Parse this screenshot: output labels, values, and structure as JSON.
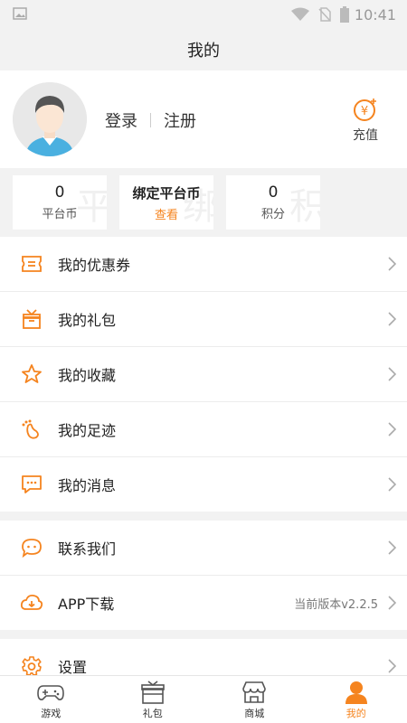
{
  "status": {
    "time": "10:41"
  },
  "title": "我的",
  "profile": {
    "login": "登录",
    "register": "注册",
    "recharge": "充值"
  },
  "stats": [
    {
      "value": "0",
      "label": "平台币",
      "watermark": "平"
    },
    {
      "value": "绑定平台币",
      "label": "查看",
      "watermark": "绑"
    },
    {
      "value": "0",
      "label": "积分",
      "watermark": "积"
    }
  ],
  "menu_group1": [
    {
      "label": "我的优惠券",
      "icon": "coupon-icon"
    },
    {
      "label": "我的礼包",
      "icon": "gift-icon"
    },
    {
      "label": "我的收藏",
      "icon": "star-icon"
    },
    {
      "label": "我的足迹",
      "icon": "footprint-icon"
    },
    {
      "label": "我的消息",
      "icon": "message-icon"
    }
  ],
  "menu_group2": [
    {
      "label": "联系我们",
      "icon": "contact-icon"
    },
    {
      "label": "APP下载",
      "icon": "cloud-download-icon",
      "extra": "当前版本v2.2.5"
    }
  ],
  "menu_group3": [
    {
      "label": "设置",
      "icon": "settings-icon"
    }
  ],
  "tabbar": [
    {
      "label": "游戏",
      "icon": "gamepad-icon"
    },
    {
      "label": "礼包",
      "icon": "gift-box-icon"
    },
    {
      "label": "商城",
      "icon": "store-icon"
    },
    {
      "label": "我的",
      "icon": "person-icon",
      "active": true
    }
  ],
  "colors": {
    "accent": "#f5841f",
    "background": "#f2f2f2"
  }
}
